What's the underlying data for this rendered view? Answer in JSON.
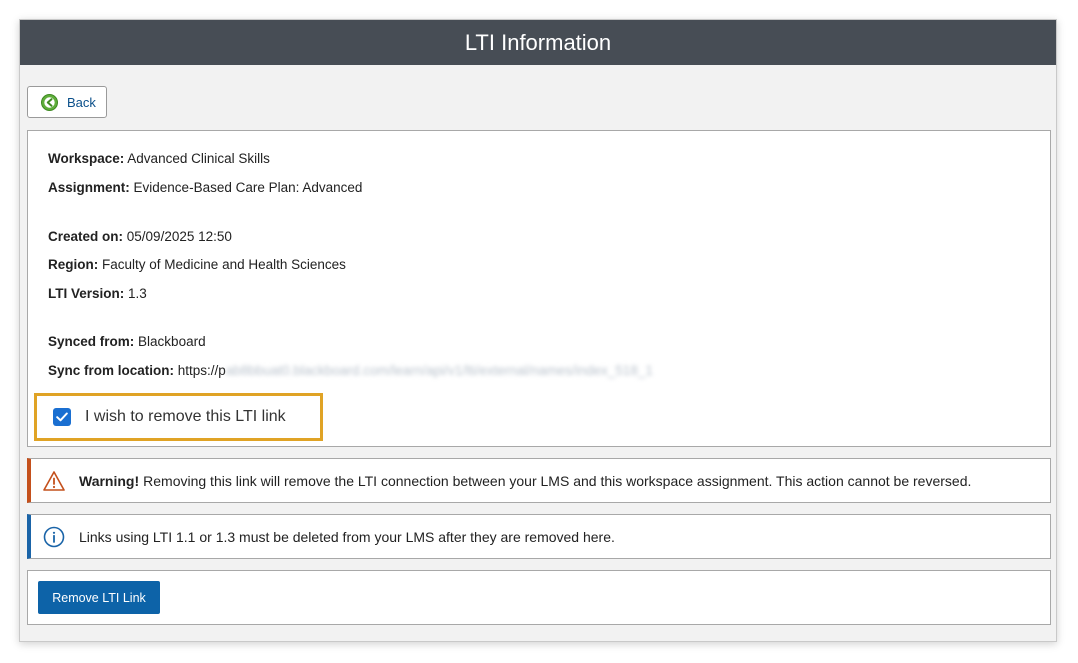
{
  "window": {
    "title": "LTI Information"
  },
  "toolbar": {
    "back_label": "Back"
  },
  "details": {
    "workspace_label": "Workspace:",
    "workspace_value": "Advanced Clinical Skills",
    "assignment_label": "Assignment:",
    "assignment_value": "Evidence-Based Care Plan: Advanced",
    "created_label": "Created on:",
    "created_value": "05/09/2025 12:50",
    "region_label": "Region:",
    "region_value": "Faculty of Medicine and Health Sciences",
    "version_label": "LTI Version:",
    "version_value": "1.3",
    "synced_label": "Synced from:",
    "synced_value": "Blackboard",
    "location_label": "Sync from location:",
    "location_value": "https://p",
    "location_redacted": "ab8bbuat0.blackboard.com/learn/api/v1/lti/external/names/index_518_1"
  },
  "confirm": {
    "label": "I wish to remove this LTI link",
    "checked": true
  },
  "warning": {
    "title": "Warning!",
    "text": "Removing this link will remove the LTI connection between your LMS and this workspace assignment. This action cannot be reversed."
  },
  "info": {
    "text": "Links using LTI 1.1 or 1.3 must be deleted from your LMS after they are removed here."
  },
  "actions": {
    "remove_label": "Remove LTI Link"
  },
  "colors": {
    "titlebar": "#474d55",
    "highlight": "#e0a325",
    "warning_accent": "#c4501c",
    "info_accent": "#1a64a8",
    "primary_button": "#0d63a8"
  },
  "icons": {
    "back": "back-arrow-circle-icon",
    "checkbox": "checkmark-icon",
    "warning": "warning-triangle-icon",
    "info": "info-circle-icon"
  }
}
